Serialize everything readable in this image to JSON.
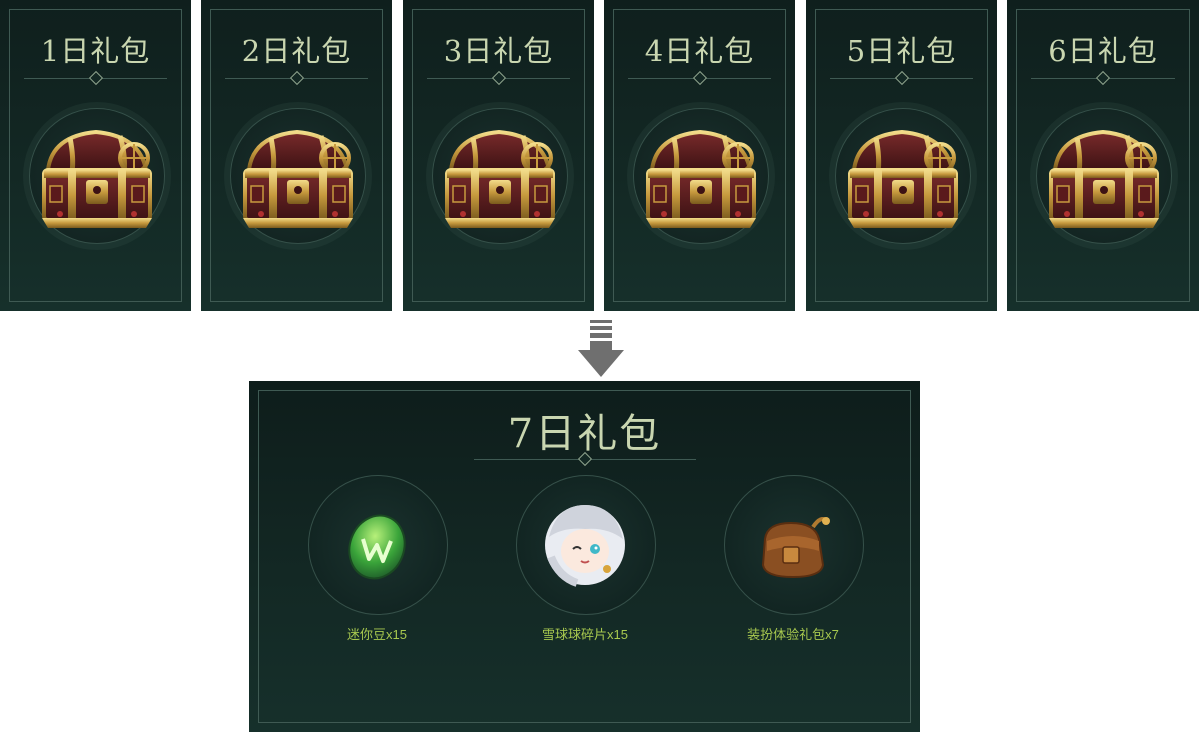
{
  "packs": [
    {
      "title": "1日礼包",
      "icon": "treasure-chest"
    },
    {
      "title": "2日礼包",
      "icon": "treasure-chest"
    },
    {
      "title": "3日礼包",
      "icon": "treasure-chest"
    },
    {
      "title": "4日礼包",
      "icon": "treasure-chest"
    },
    {
      "title": "5日礼包",
      "icon": "treasure-chest"
    },
    {
      "title": "6日礼包",
      "icon": "treasure-chest"
    }
  ],
  "final_pack": {
    "title": "7日礼包",
    "rewards": [
      {
        "label": "迷你豆x15",
        "icon": "green-egg"
      },
      {
        "label": "雪球球碎片x15",
        "icon": "character-portrait"
      },
      {
        "label": "装扮体验礼包x7",
        "icon": "brown-bag"
      }
    ]
  },
  "colors": {
    "panel_bg": "#132824",
    "frame": "#3f5a53",
    "title_text": "#c9d6b0",
    "reward_text": "#a8c94f",
    "arrow": "#6f6f6f"
  }
}
